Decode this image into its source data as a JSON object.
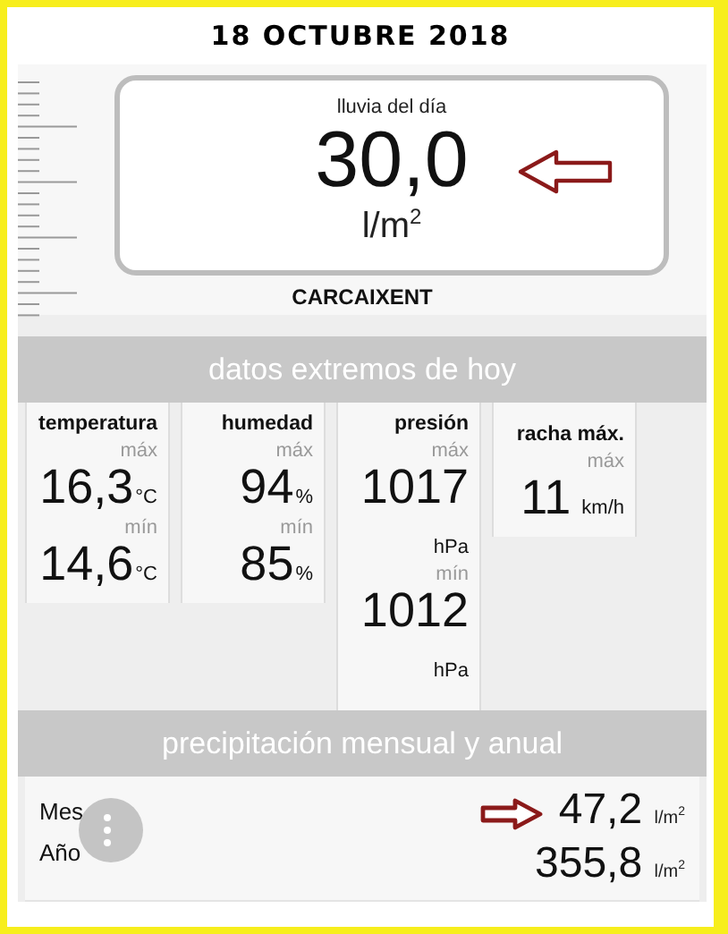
{
  "date": "18 OCTUBRE 2018",
  "rain_today": {
    "label": "lluvia del día",
    "value": "30,0",
    "unit": "l/m$^{2}$"
  },
  "station": "CARCAIXENT",
  "extremes": {
    "title": "datos extremos de hoy",
    "cells": [
      {
        "title": "temperatura",
        "kind": "inline",
        "readings": [
          {
            "label": "máx",
            "value": "16,3",
            "unit": "°C"
          },
          {
            "label": "mín",
            "value": "14,6",
            "unit": "°C"
          }
        ]
      },
      {
        "title": "humedad",
        "kind": "inline",
        "readings": [
          {
            "label": "máx",
            "value": "94",
            "unit": "%"
          },
          {
            "label": "mín",
            "value": "85",
            "unit": "%"
          }
        ]
      },
      {
        "title": "presión",
        "kind": "below",
        "readings": [
          {
            "label": "máx",
            "value": "1017",
            "unit": "hPa"
          },
          {
            "label": "mín",
            "value": "1012",
            "unit": "hPa"
          }
        ]
      },
      {
        "title": "racha máx.",
        "kind": "inline",
        "readings": [
          {
            "label": "máx",
            "value": "11",
            "unit": "km/h"
          }
        ]
      }
    ]
  },
  "precipitation": {
    "title": "precipitación mensual y anual",
    "rows": [
      {
        "label": "Mes",
        "value": "47,2",
        "unit": "l/m$^{2}$",
        "arrow": true
      },
      {
        "label": "Año",
        "value": "355,8",
        "unit": "l/m$^{2}$",
        "arrow": false
      }
    ]
  }
}
